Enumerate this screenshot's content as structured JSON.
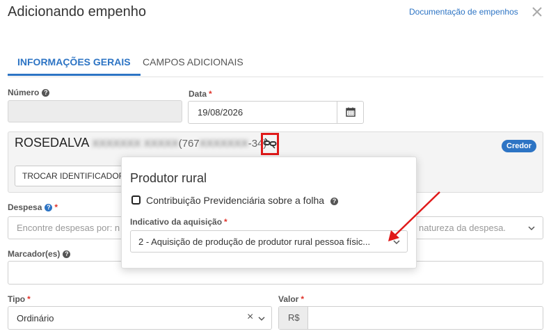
{
  "modal": {
    "title": "Adicionando empenho",
    "doc_link": "Documentação de empenhos"
  },
  "tabs": [
    {
      "label": "INFORMAÇÕES GERAIS",
      "active": true
    },
    {
      "label": "CAMPOS ADICIONAIS",
      "active": false
    }
  ],
  "numero": {
    "label": "Número",
    "value": ""
  },
  "data": {
    "label": "Data",
    "required": "*",
    "value": "19/08/2026"
  },
  "credor": {
    "name": "ROSEDALVA",
    "name_hidden": "XXXXXXX XXXXX",
    "doc_prefix": "(767",
    "doc_hidden": "XXXXXXX",
    "doc_suffix": "-34)",
    "badge": "Credor",
    "change_button": "TROCAR IDENTIFICADOR"
  },
  "despesa": {
    "label": "Despesa",
    "required": "*",
    "placeholder_left": "Encontre despesas por: n",
    "placeholder_right": "natureza da despesa."
  },
  "marcadores": {
    "label": "Marcador(es)",
    "value": ""
  },
  "tipo": {
    "label": "Tipo",
    "required": "*",
    "value": "Ordinário",
    "clear": "×"
  },
  "valor": {
    "label": "Valor",
    "required": "*",
    "prefix": "R$",
    "value": ""
  },
  "popup": {
    "title": "Produtor rural",
    "checkbox_label": "Contribuição Previdenciária sobre a folha",
    "checkbox_checked": false,
    "select_label": "Indicativo da aquisição",
    "select_required": "*",
    "select_value": "2 - Aquisição de produção de produtor rural pessoa físic..."
  },
  "colors": {
    "accent": "#2d74c4",
    "required": "#e0342b",
    "annotation": "#e01919"
  }
}
